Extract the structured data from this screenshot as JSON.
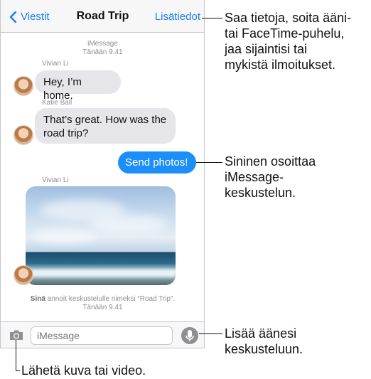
{
  "navbar": {
    "back_label": "Viestit",
    "title": "Road Trip",
    "details_label": "Lisätiedot"
  },
  "conversation": {
    "service_label": "iMessage",
    "time_top": {
      "day": "Tänään",
      "time": "9.41"
    },
    "messages": [
      {
        "sender": "Vivian Li",
        "text": "Hey, I’m home."
      },
      {
        "sender": "Katie Ball",
        "text_line1": "That’s great. How was the",
        "text_line2": "road trip?"
      },
      {
        "text": "Send photos!"
      },
      {
        "sender": "Vivian Li"
      }
    ],
    "rename_notice": {
      "you": "Sinä",
      "rest": "annoit keskustelulle nimeksi “Road Trip”.",
      "day": "Tänään",
      "time": "9.41"
    }
  },
  "input": {
    "placeholder": "iMessage",
    "camera_icon": "camera-icon",
    "mic_icon": "microphone-icon"
  },
  "callouts": {
    "details": [
      "Saa tietoja, soita ääni-",
      "tai FaceTime-puhelu,",
      "jaa sijaintisi tai",
      "mykistä ilmoitukset."
    ],
    "blue": [
      "Sininen osoittaa",
      "iMessage-",
      "keskustelun."
    ],
    "audio": [
      "Lisää äänesi",
      "keskusteluun."
    ],
    "camera": "Lähetä kuva tai video."
  },
  "colors": {
    "accent": "#1a7cf7",
    "outgoing_bubble": "#1c8ef9",
    "incoming_bubble": "#e5e5ea"
  }
}
